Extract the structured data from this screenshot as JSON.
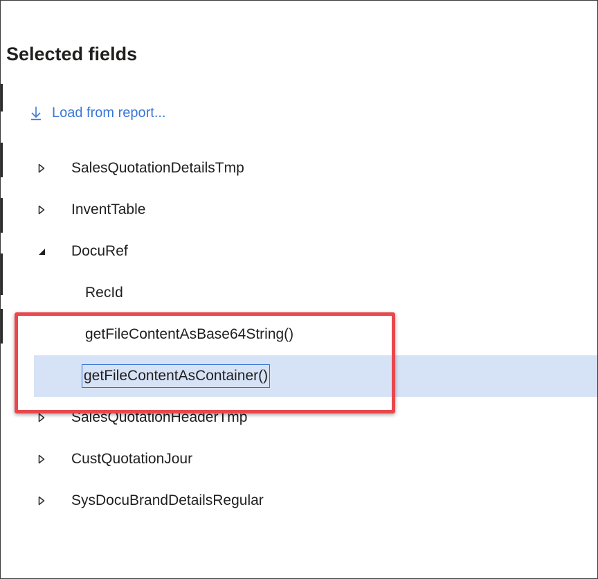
{
  "panel": {
    "title": "Selected fields",
    "load_link_label": "Load from report..."
  },
  "tree": [
    {
      "label": "SalesQuotationDetailsTmp",
      "level": 0,
      "state": "collapsed"
    },
    {
      "label": "InventTable",
      "level": 0,
      "state": "collapsed"
    },
    {
      "label": "DocuRef",
      "level": 0,
      "state": "expanded"
    },
    {
      "label": "RecId",
      "level": 1
    },
    {
      "label": "getFileContentAsBase64String()",
      "level": 1
    },
    {
      "label": "getFileContentAsContainer()",
      "level": 1,
      "selected": true
    },
    {
      "label": "SalesQuotationHeaderTmp",
      "level": 0,
      "state": "collapsed"
    },
    {
      "label": "CustQuotationJour",
      "level": 0,
      "state": "collapsed"
    },
    {
      "label": "SysDocuBrandDetailsRegular",
      "level": 0,
      "state": "collapsed"
    }
  ],
  "colors": {
    "link": "#3a77d6",
    "selection_background": "#d6e2f5",
    "selection_border": "#2f6fd8",
    "annotation_box": "#e8474c"
  },
  "icons": {
    "load": "arrow-down-icon",
    "collapsed": "caret-right-icon",
    "expanded": "caret-down-icon"
  }
}
